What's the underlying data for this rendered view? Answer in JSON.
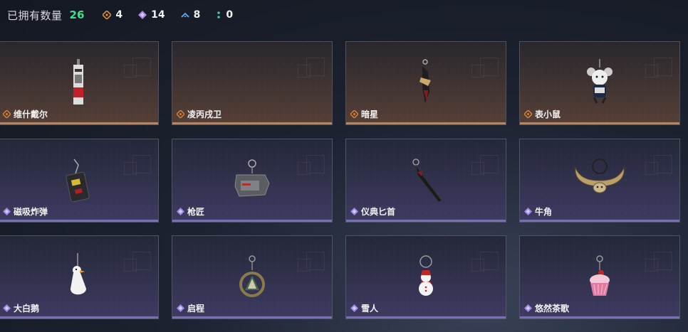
{
  "header": {
    "title": "已拥有数量",
    "total": "26",
    "stats": [
      {
        "icon": "orange-diamond-icon",
        "value": "4",
        "color": "#e08a3a"
      },
      {
        "icon": "purple-diamond-icon",
        "value": "14",
        "color": "#a48af0"
      },
      {
        "icon": "blue-chevron-icon",
        "value": "8",
        "color": "#5aa0e6"
      },
      {
        "icon": "teal-dots-icon",
        "value": "0",
        "color": "#3ec8b0"
      }
    ]
  },
  "colors": {
    "gold_rarity": "#d9823a",
    "purple_rarity": "#a187f2",
    "accent_green": "#38e38a"
  },
  "items": [
    {
      "name": "维什戴尔",
      "rarity": "gold",
      "icon": "tag-charm-icon"
    },
    {
      "name": "凌丙戌卫",
      "rarity": "gold",
      "icon": "empty-slot"
    },
    {
      "name": "暗星",
      "rarity": "gold",
      "icon": "blade-charm-icon"
    },
    {
      "name": "表小鼠",
      "rarity": "gold",
      "icon": "mouse-charm-icon"
    },
    {
      "name": "磁吸炸弹",
      "rarity": "purple",
      "icon": "bomb-charm-icon"
    },
    {
      "name": "枪匠",
      "rarity": "purple",
      "icon": "dogtag-charm-icon"
    },
    {
      "name": "仪典匕首",
      "rarity": "purple",
      "icon": "dagger-charm-icon"
    },
    {
      "name": "牛角",
      "rarity": "purple",
      "icon": "horns-charm-icon"
    },
    {
      "name": "大白鹅",
      "rarity": "purple",
      "icon": "goose-charm-icon"
    },
    {
      "name": "启程",
      "rarity": "purple",
      "icon": "ring-charm-icon"
    },
    {
      "name": "雪人",
      "rarity": "purple",
      "icon": "snowman-charm-icon"
    },
    {
      "name": "悠然茶歌",
      "rarity": "purple",
      "icon": "cupcake-charm-icon"
    }
  ]
}
